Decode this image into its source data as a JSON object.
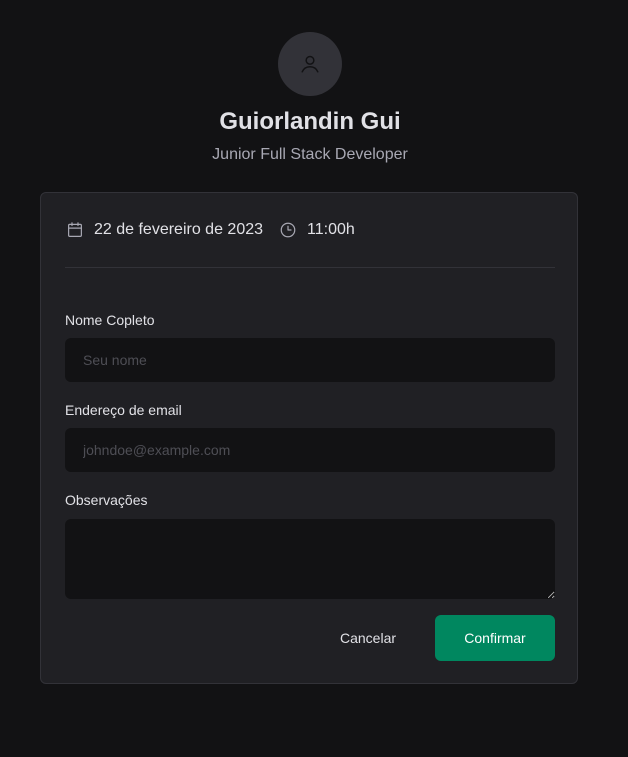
{
  "profile": {
    "name": "Guiorlandin Gui",
    "role": "Junior Full Stack Developer",
    "avatar_icon": "user-icon"
  },
  "schedule": {
    "date": "22 de fevereiro de 2023",
    "time": "11:00h",
    "date_icon": "calendar-icon",
    "time_icon": "clock-icon"
  },
  "form": {
    "name_label": "Nome Copleto",
    "name_placeholder": "Seu nome",
    "email_label": "Endereço de email",
    "email_placeholder": "johndoe@example.com",
    "notes_label": "Observações",
    "notes_value": ""
  },
  "actions": {
    "cancel_label": "Cancelar",
    "confirm_label": "Confirmar"
  },
  "colors": {
    "background": "#121214",
    "card": "#202024",
    "input": "#121214",
    "accent": "#00875f",
    "text": "#e1e1e6",
    "muted": "#a8a8b3"
  }
}
